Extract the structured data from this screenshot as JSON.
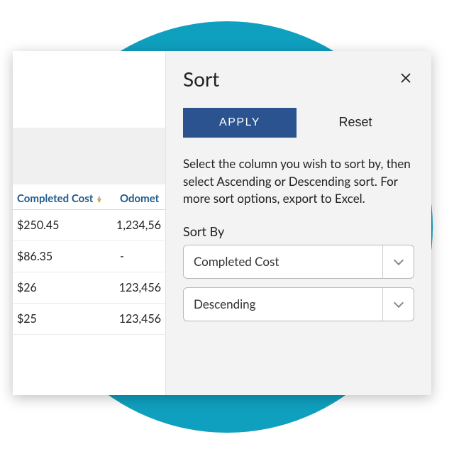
{
  "panel": {
    "title": "Sort",
    "apply_label": "APPLY",
    "reset_label": "Reset",
    "instructions": "Select the column you wish to sort by, then select Ascending or Descending sort. For more sort options, export to Excel.",
    "sort_by_label": "Sort By",
    "column_select": "Completed Cost",
    "direction_select": "Descending"
  },
  "table": {
    "headers": {
      "cost": "Completed Cost",
      "odometer": "Odomet"
    },
    "rows": [
      {
        "cost": "$250.45",
        "odometer": "1,234,56"
      },
      {
        "cost": "$86.35",
        "odometer": "-"
      },
      {
        "cost": "$26",
        "odometer": "123,456"
      },
      {
        "cost": "$25",
        "odometer": "123,456"
      }
    ]
  }
}
